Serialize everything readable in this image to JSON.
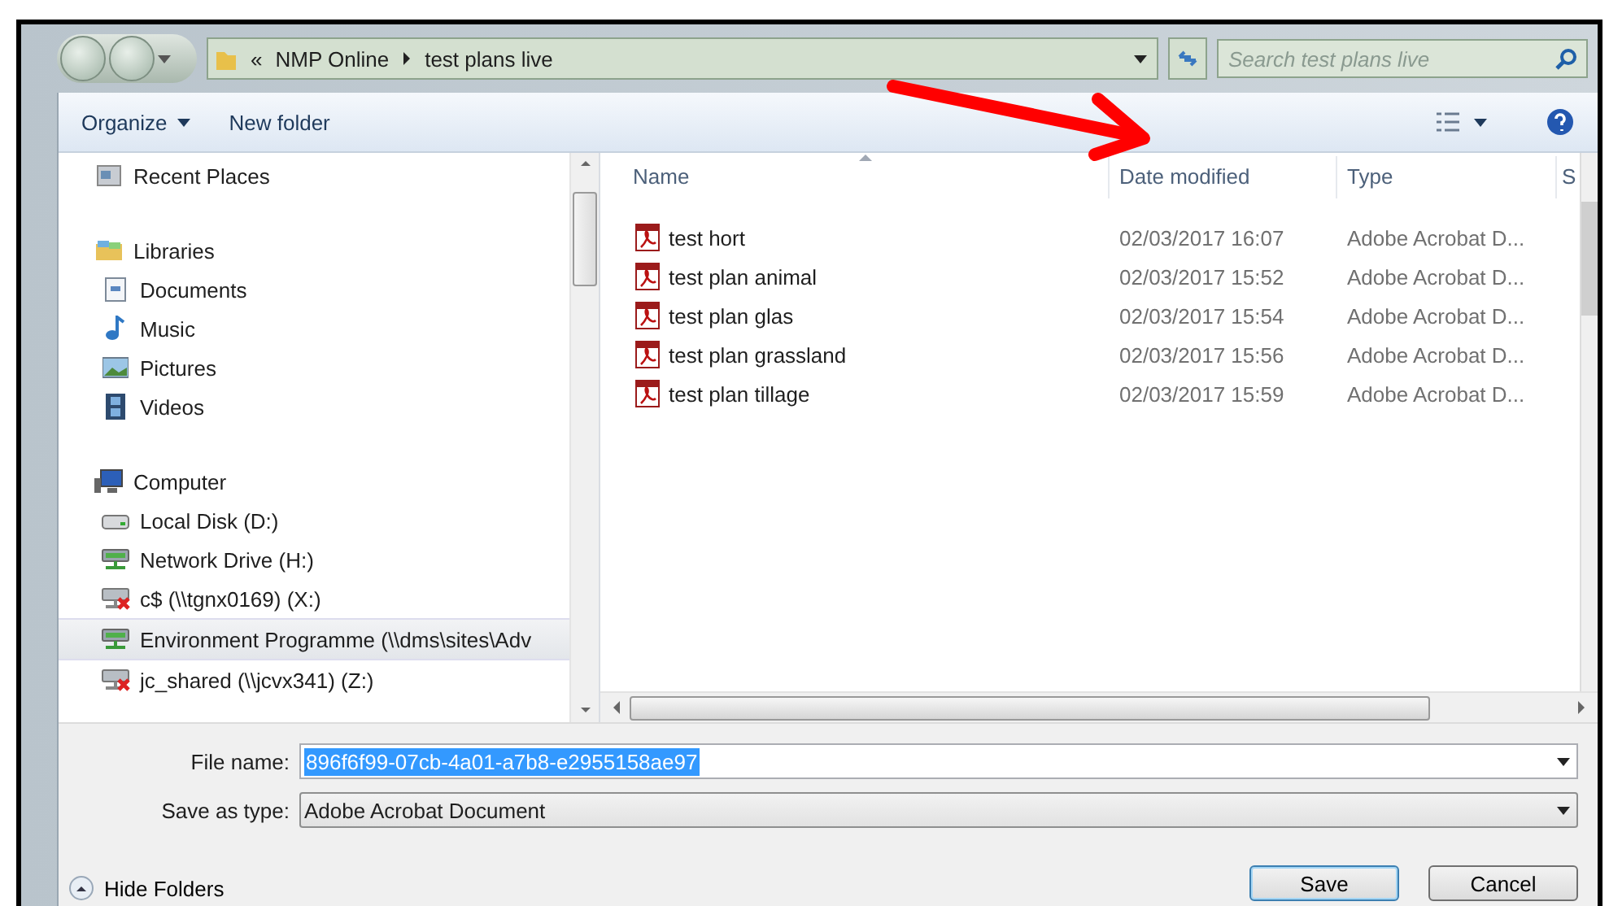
{
  "address_bar": {
    "overflow": "«",
    "path": [
      {
        "label": "NMP Online"
      },
      {
        "label": "test plans live"
      }
    ]
  },
  "search": {
    "placeholder": "Search test plans live"
  },
  "toolbar": {
    "buttons": [
      {
        "label": "Organize",
        "dropdown": true
      },
      {
        "label": "New folder",
        "dropdown": false
      }
    ]
  },
  "navigation": {
    "items": [
      {
        "label": "Recent Places",
        "kind": "recent",
        "selected": false
      },
      {
        "label": "Libraries",
        "kind": "library",
        "selected": false,
        "children": [
          {
            "label": "Documents",
            "kind": "documents",
            "selected": false
          },
          {
            "label": "Music",
            "kind": "music",
            "selected": false
          },
          {
            "label": "Pictures",
            "kind": "pictures",
            "selected": false
          },
          {
            "label": "Videos",
            "kind": "videos",
            "selected": false
          }
        ]
      },
      {
        "label": "Computer",
        "kind": "computer",
        "selected": false,
        "children": [
          {
            "label": "Local Disk (D:)",
            "kind": "disk",
            "selected": false
          },
          {
            "label": "Network Drive (H:)",
            "kind": "network",
            "selected": false
          },
          {
            "label": "c$ (\\\\tgnx0169) (X:)",
            "kind": "disconnected",
            "selected": false
          },
          {
            "label": "Environment Programme (\\\\dms\\sites\\Adv",
            "kind": "network",
            "selected": true
          },
          {
            "label": "jc_shared (\\\\jcvx341) (Z:)",
            "kind": "disconnected",
            "selected": false
          }
        ]
      }
    ]
  },
  "file_list": {
    "columns": [
      "Name",
      "Date modified",
      "Type",
      "S"
    ],
    "rows": [
      {
        "name": "test hort",
        "date": "02/03/2017 16:07",
        "type": "Adobe Acrobat D..."
      },
      {
        "name": "test plan animal",
        "date": "02/03/2017 15:52",
        "type": "Adobe Acrobat D..."
      },
      {
        "name": "test plan glas",
        "date": "02/03/2017 15:54",
        "type": "Adobe Acrobat D..."
      },
      {
        "name": "test plan grassland",
        "date": "02/03/2017 15:56",
        "type": "Adobe Acrobat D..."
      },
      {
        "name": "test plan tillage",
        "date": "02/03/2017 15:59",
        "type": "Adobe Acrobat D..."
      }
    ]
  },
  "file_name": {
    "label": "File name:",
    "value": "896f6f99-07cb-4a01-a7b8-e2955158ae97"
  },
  "save_as_type": {
    "label": "Save as type:",
    "value": "Adobe Acrobat Document"
  },
  "hide_folders": {
    "label": "Hide Folders"
  },
  "buttons": [
    {
      "label": "Save",
      "default": true
    },
    {
      "label": "Cancel",
      "default": false
    }
  ]
}
